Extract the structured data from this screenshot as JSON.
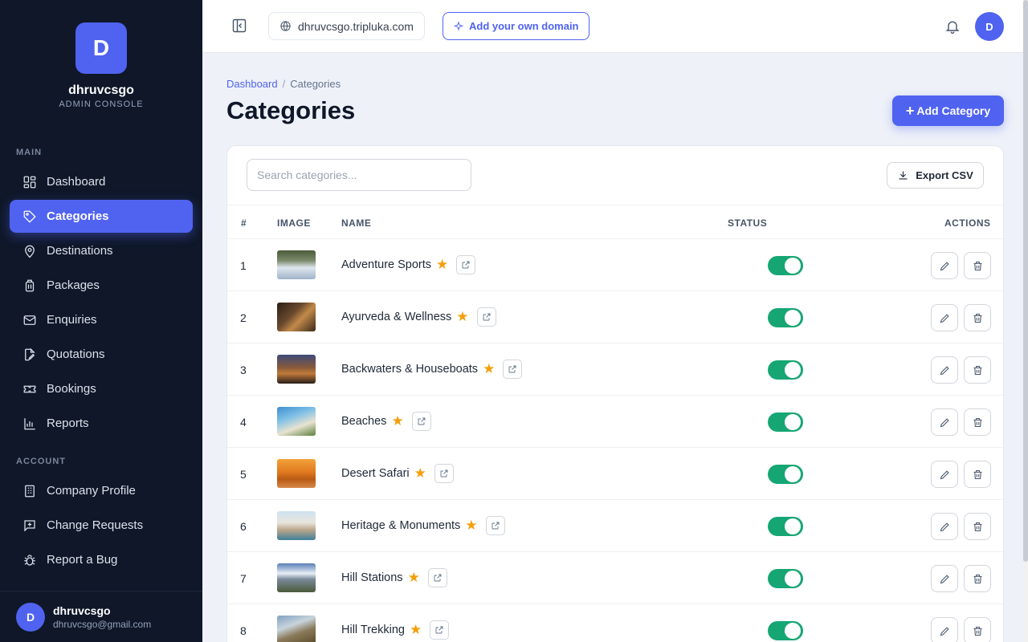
{
  "brand": {
    "initial": "D",
    "name": "dhruvcsgo",
    "subtitle": "ADMIN CONSOLE"
  },
  "sidebar": {
    "main_label": "MAIN",
    "main_items": [
      {
        "label": "Dashboard",
        "icon": "dashboard-icon"
      },
      {
        "label": "Categories",
        "icon": "tag-icon",
        "active": true
      },
      {
        "label": "Destinations",
        "icon": "map-pin-icon"
      },
      {
        "label": "Packages",
        "icon": "luggage-icon"
      },
      {
        "label": "Enquiries",
        "icon": "mail-icon"
      },
      {
        "label": "Quotations",
        "icon": "file-edit-icon"
      },
      {
        "label": "Bookings",
        "icon": "ticket-icon"
      },
      {
        "label": "Reports",
        "icon": "bar-chart-icon"
      }
    ],
    "account_label": "ACCOUNT",
    "account_items": [
      {
        "label": "Company Profile",
        "icon": "building-icon"
      },
      {
        "label": "Change Requests",
        "icon": "message-plus-icon"
      },
      {
        "label": "Report a Bug",
        "icon": "bug-icon"
      }
    ]
  },
  "user": {
    "initial": "D",
    "name": "dhruvcsgo",
    "email": "dhruvcsgo@gmail.com"
  },
  "topbar": {
    "domain": "dhruvcsgo.tripluka.com",
    "add_domain_label": "Add your own domain",
    "avatar_initial": "D"
  },
  "breadcrumb": {
    "parent": "Dashboard",
    "separator": "/",
    "current": "Categories"
  },
  "page": {
    "title": "Categories",
    "add_button": "Add Category"
  },
  "toolbar": {
    "search_placeholder": "Search categories...",
    "export_label": "Export CSV"
  },
  "table": {
    "headers": {
      "num": "#",
      "image": "IMAGE",
      "name": "NAME",
      "status": "STATUS",
      "actions": "ACTIONS"
    },
    "rows": [
      {
        "num": "1",
        "name": "Adventure Sports",
        "featured": true,
        "active": true
      },
      {
        "num": "2",
        "name": "Ayurveda & Wellness",
        "featured": true,
        "active": true
      },
      {
        "num": "3",
        "name": "Backwaters & Houseboats",
        "featured": true,
        "active": true
      },
      {
        "num": "4",
        "name": "Beaches",
        "featured": true,
        "active": true
      },
      {
        "num": "5",
        "name": "Desert Safari",
        "featured": true,
        "active": true
      },
      {
        "num": "6",
        "name": "Heritage & Monuments",
        "featured": true,
        "active": true
      },
      {
        "num": "7",
        "name": "Hill Stations",
        "featured": true,
        "active": true
      },
      {
        "num": "8",
        "name": "Hill Trekking",
        "featured": true,
        "active": true
      }
    ]
  },
  "colors": {
    "accent": "#4f63f0",
    "sidebar_bg": "#0f1729",
    "toggle_on": "#16a673",
    "star": "#f59e0b"
  }
}
